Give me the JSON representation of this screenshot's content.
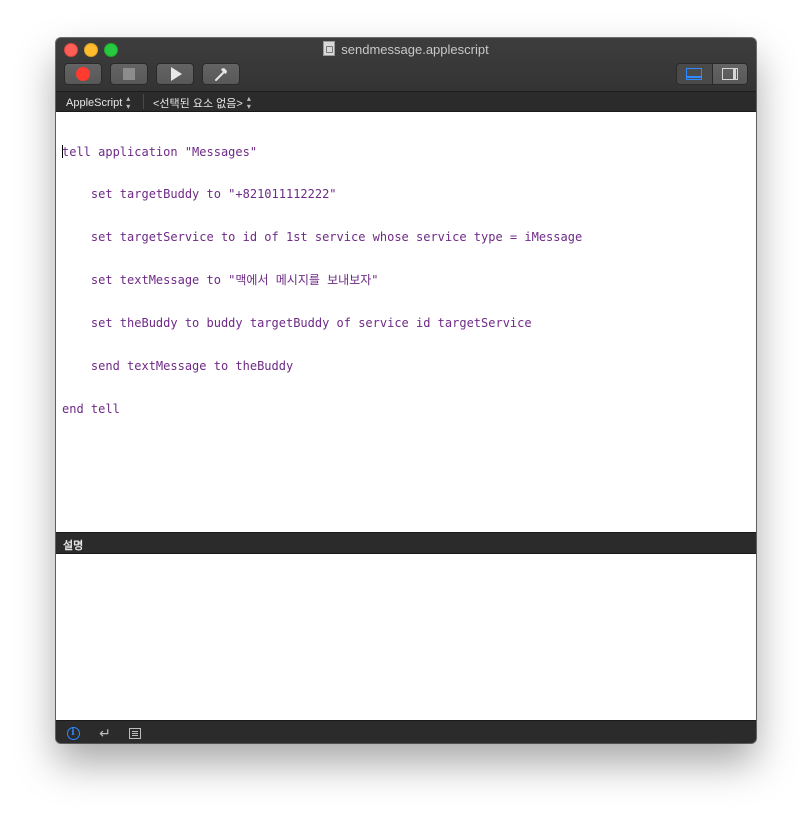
{
  "window": {
    "title": "sendmessage.applescript"
  },
  "toolbar": {
    "record_icon": "record-icon",
    "stop_icon": "stop-icon",
    "run_icon": "run-icon",
    "compile_icon": "hammer-icon",
    "view_toggle": [
      "bottom-pane-icon",
      "side-pane-icon"
    ],
    "active_view": "bottom-pane"
  },
  "navigation": {
    "language": "AppleScript",
    "selection": "<선택된 요소 없음>"
  },
  "editor": {
    "lines": [
      "tell application \"Messages\"",
      "    set targetBuddy to \"+821011112222\"",
      "    set targetService to id of 1st service whose service type = iMessage",
      "    set textMessage to \"맥에서 메시지를 보내보자\"",
      "    set theBuddy to buddy targetBuddy of service id targetService",
      "    send textMessage to theBuddy",
      "end tell"
    ],
    "text_color": "#6e2a86"
  },
  "description": {
    "label": "설명"
  },
  "bottom_bar": {
    "icons": [
      "info-icon",
      "return-icon",
      "list-icon"
    ],
    "active": "info-icon",
    "accent": "#2f8bff"
  }
}
